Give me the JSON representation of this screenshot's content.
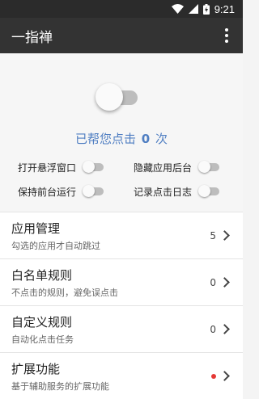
{
  "status_bar": {
    "time": "9:21",
    "icons": [
      "wifi-icon",
      "signal-icon",
      "battery-icon"
    ]
  },
  "app_bar": {
    "title": "一指禅",
    "menu_icon": "more-vert-icon"
  },
  "main_switch": {
    "on": false
  },
  "counter": {
    "prefix": "已帮您点击",
    "count": "0",
    "suffix": "次"
  },
  "options": {
    "floating_window": {
      "label": "打开悬浮窗口",
      "on": false
    },
    "hide_from_recents": {
      "label": "隐藏应用后台",
      "on": false
    },
    "keep_foreground": {
      "label": "保持前台运行",
      "on": false
    },
    "log_clicks": {
      "label": "记录点击日志",
      "on": false
    }
  },
  "menu": [
    {
      "title": "应用管理",
      "subtitle": "勾选的应用才自动跳过",
      "value": "5"
    },
    {
      "title": "白名单规则",
      "subtitle": "不点击的规则，避免误点击",
      "value": "0"
    },
    {
      "title": "自定义规则",
      "subtitle": "自动化点击任务",
      "value": "0"
    },
    {
      "title": "扩展功能",
      "subtitle": "基于辅助服务的扩展功能",
      "value": ""
    }
  ],
  "colors": {
    "app_bar": "#333333",
    "accent_text": "#4f7ec2",
    "badge_dot": "#e53935"
  }
}
